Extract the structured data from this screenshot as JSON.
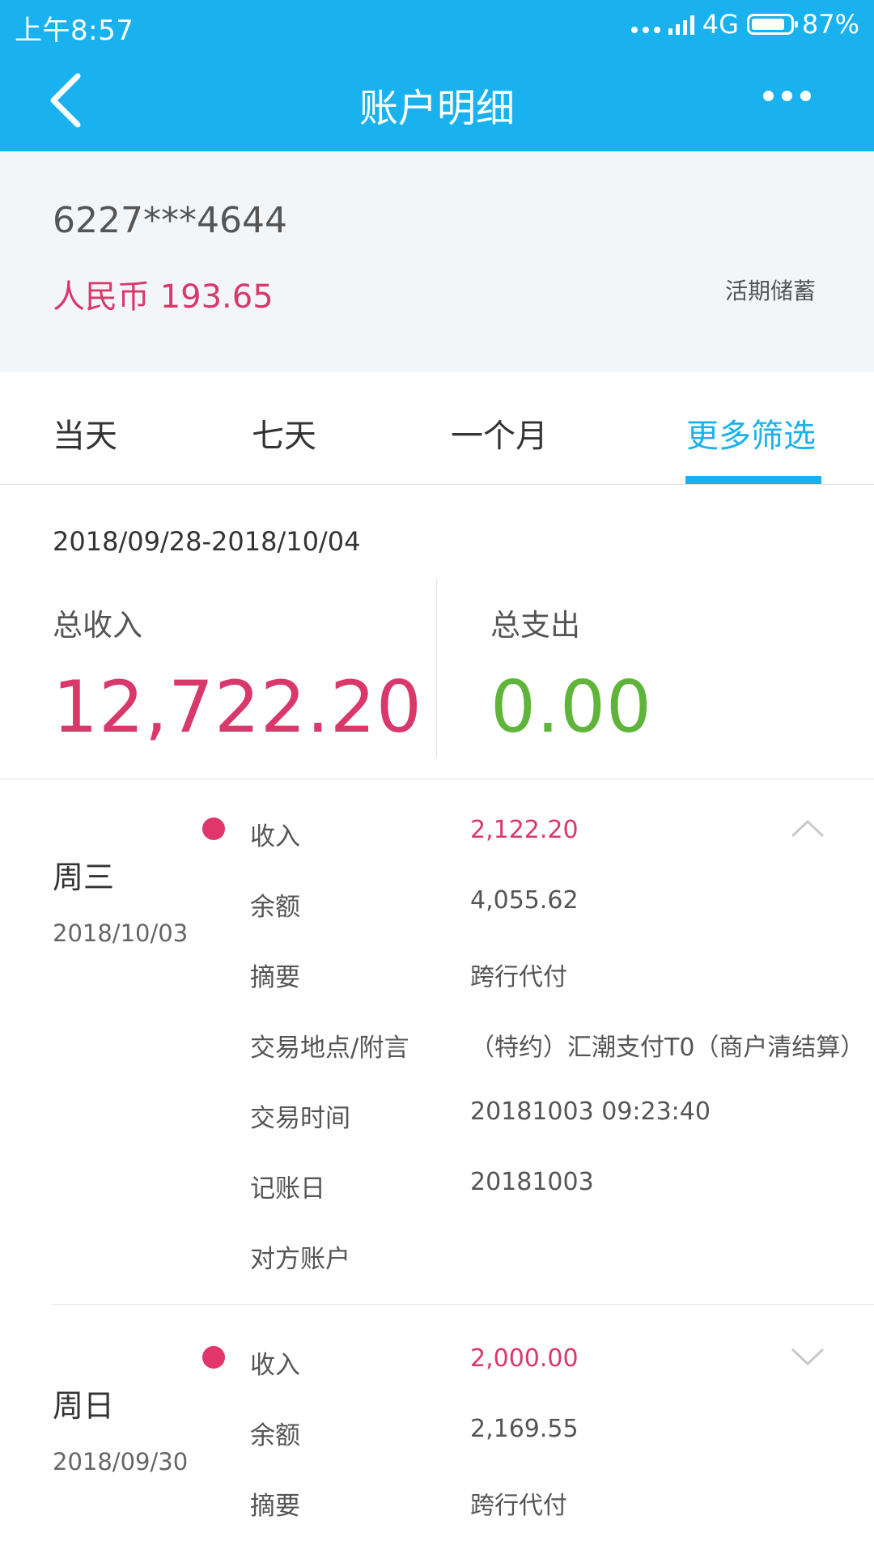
{
  "status_bar": {
    "time": "上午8:57",
    "network": "4G",
    "battery_text": "87%",
    "battery_level": 0.87
  },
  "header": {
    "title": "账户明细"
  },
  "account": {
    "number": "6227***4644",
    "balance": "人民币 193.65",
    "type": "活期储蓄"
  },
  "tabs": [
    {
      "label": "当天"
    },
    {
      "label": "七天"
    },
    {
      "label": "一个月"
    },
    {
      "label": "更多筛选",
      "active": true
    }
  ],
  "summary": {
    "date_range": "2018/09/28-2018/10/04",
    "income_label": "总收入",
    "income_value": "12,722.20",
    "expense_label": "总支出",
    "expense_value": "0.00"
  },
  "transactions": [
    {
      "weekday": "周三",
      "date": "2018/10/03",
      "expanded": true,
      "rows": [
        {
          "label": "收入",
          "value": "2,122.20"
        },
        {
          "label": "余额",
          "value": "4,055.62"
        },
        {
          "label": "摘要",
          "value": "跨行代付"
        },
        {
          "label": "交易地点/附言",
          "value": "（特约）汇潮支付T0（商户清结算）"
        },
        {
          "label": "交易时间",
          "value": "20181003 09:23:40"
        },
        {
          "label": "记账日",
          "value": "20181003"
        },
        {
          "label": "对方账户",
          "value": ""
        }
      ]
    },
    {
      "weekday": "周日",
      "date": "2018/09/30",
      "expanded": false,
      "rows": [
        {
          "label": "收入",
          "value": "2,000.00"
        },
        {
          "label": "余额",
          "value": "2,169.55"
        },
        {
          "label": "摘要",
          "value": "跨行代付"
        }
      ]
    }
  ],
  "colors": {
    "primary": "#19b2ee",
    "income": "#d9386a",
    "expense": "#5fb53a",
    "dot": "#e0366a"
  },
  "icons": {
    "back": "chevron-left-icon",
    "more": "more-dots-icon",
    "collapse": "chevron-up-icon",
    "expand": "chevron-down-icon"
  }
}
